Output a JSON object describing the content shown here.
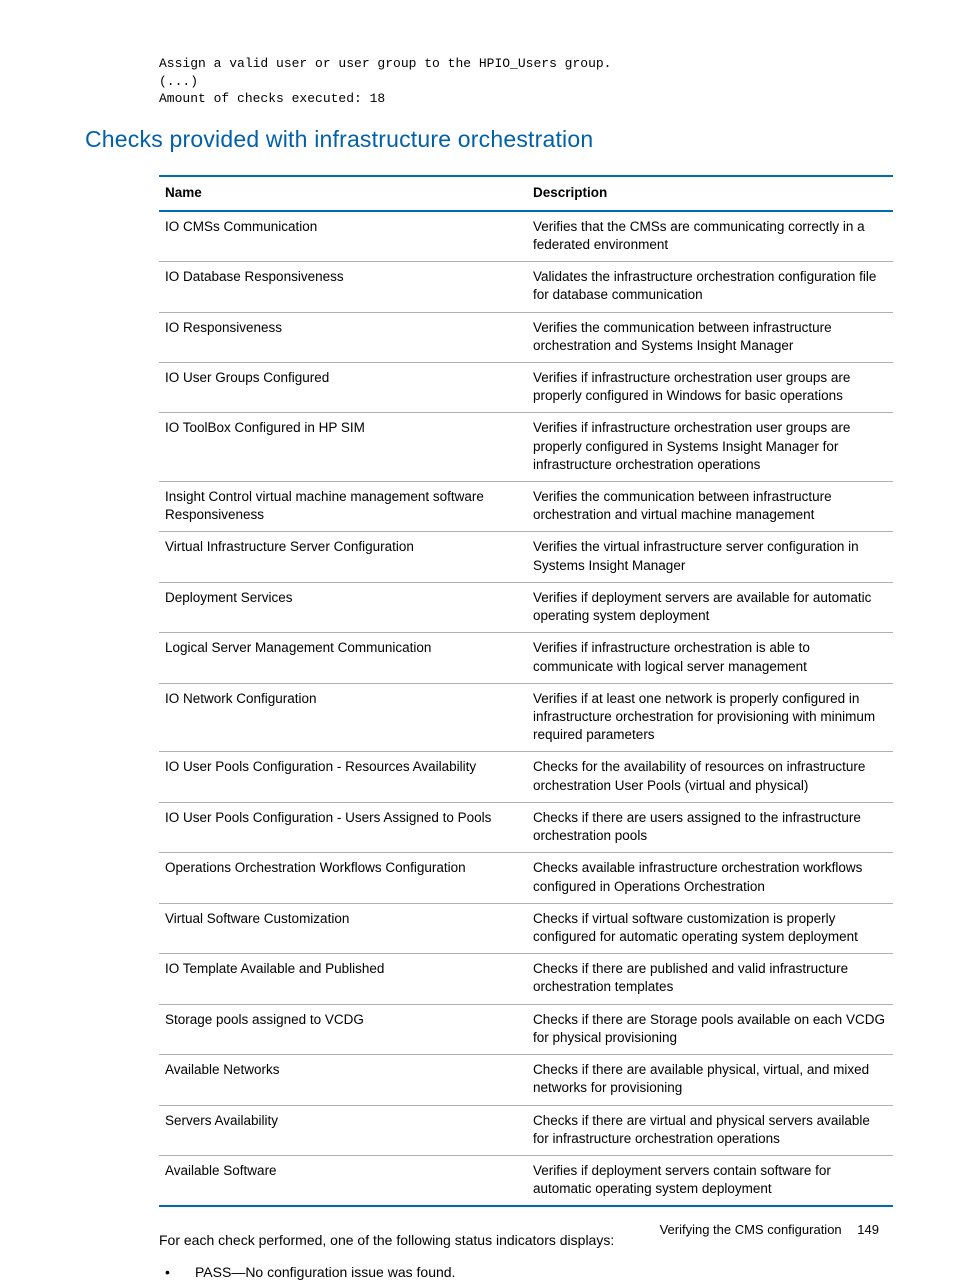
{
  "code": {
    "line1": "Assign a valid user or user group to the HPIO_Users group.",
    "line2": "(...)",
    "line3": "Amount of checks executed: 18"
  },
  "heading": "Checks provided with infrastructure orchestration",
  "table": {
    "headers": {
      "name": "Name",
      "description": "Description"
    },
    "rows": [
      {
        "name": "IO CMSs Communication",
        "desc": "Verifies that the CMSs are communicating correctly in a federated environment"
      },
      {
        "name": "IO Database Responsiveness",
        "desc": "Validates the infrastructure orchestration configuration file for database communication"
      },
      {
        "name": "IO Responsiveness",
        "desc": "Verifies the communication between infrastructure orchestration and Systems Insight Manager"
      },
      {
        "name": "IO User Groups Configured",
        "desc": "Verifies if infrastructure orchestration user groups are properly configured in Windows for basic operations"
      },
      {
        "name": "IO ToolBox Configured in HP SIM",
        "desc": "Verifies if infrastructure orchestration user groups are properly configured in Systems Insight Manager for infrastructure orchestration operations"
      },
      {
        "name": "Insight Control virtual machine management software Responsiveness",
        "desc": "Verifies the communication between infrastructure orchestration and virtual machine management"
      },
      {
        "name": "Virtual Infrastructure Server Configuration",
        "desc": "Verifies the virtual infrastructure server configuration in Systems Insight Manager"
      },
      {
        "name": "Deployment Services",
        "desc": "Verifies if deployment servers are available for automatic operating system deployment"
      },
      {
        "name": "Logical Server Management Communication",
        "desc": "Verifies if infrastructure orchestration is able to communicate with logical server management"
      },
      {
        "name": "IO Network Configuration",
        "desc": "Verifies if at least one network is properly configured in infrastructure orchestration for provisioning with minimum required parameters"
      },
      {
        "name": "IO User Pools Configuration - Resources Availability",
        "desc": "Checks for the availability of resources on infrastructure orchestration User Pools (virtual and physical)"
      },
      {
        "name": "IO User Pools Configuration - Users Assigned to Pools",
        "desc": "Checks if there are users assigned to the infrastructure orchestration pools"
      },
      {
        "name": "Operations Orchestration Workflows Configuration",
        "desc": "Checks available infrastructure orchestration workflows configured in Operations Orchestration"
      },
      {
        "name": "Virtual Software Customization",
        "desc": "Checks if virtual software customization is properly configured for automatic operating system deployment"
      },
      {
        "name": "IO Template Available and Published",
        "desc": "Checks if there are published and valid infrastructure orchestration templates"
      },
      {
        "name": "Storage pools assigned to VCDG",
        "desc": "Checks if there are Storage pools available on each VCDG for physical provisioning"
      },
      {
        "name": "Available Networks",
        "desc": "Checks if there are available physical, virtual, and mixed networks for provisioning"
      },
      {
        "name": "Servers Availability",
        "desc": "Checks if there are virtual and physical servers available for infrastructure orchestration operations"
      },
      {
        "name": "Available Software",
        "desc": "Verifies if deployment servers contain software for automatic operating system deployment"
      }
    ]
  },
  "para": "For each check performed, one of the following status indicators displays:",
  "bullet": "PASS—No configuration issue was found.",
  "footer": {
    "title": "Verifying the CMS configuration",
    "page": "149"
  }
}
